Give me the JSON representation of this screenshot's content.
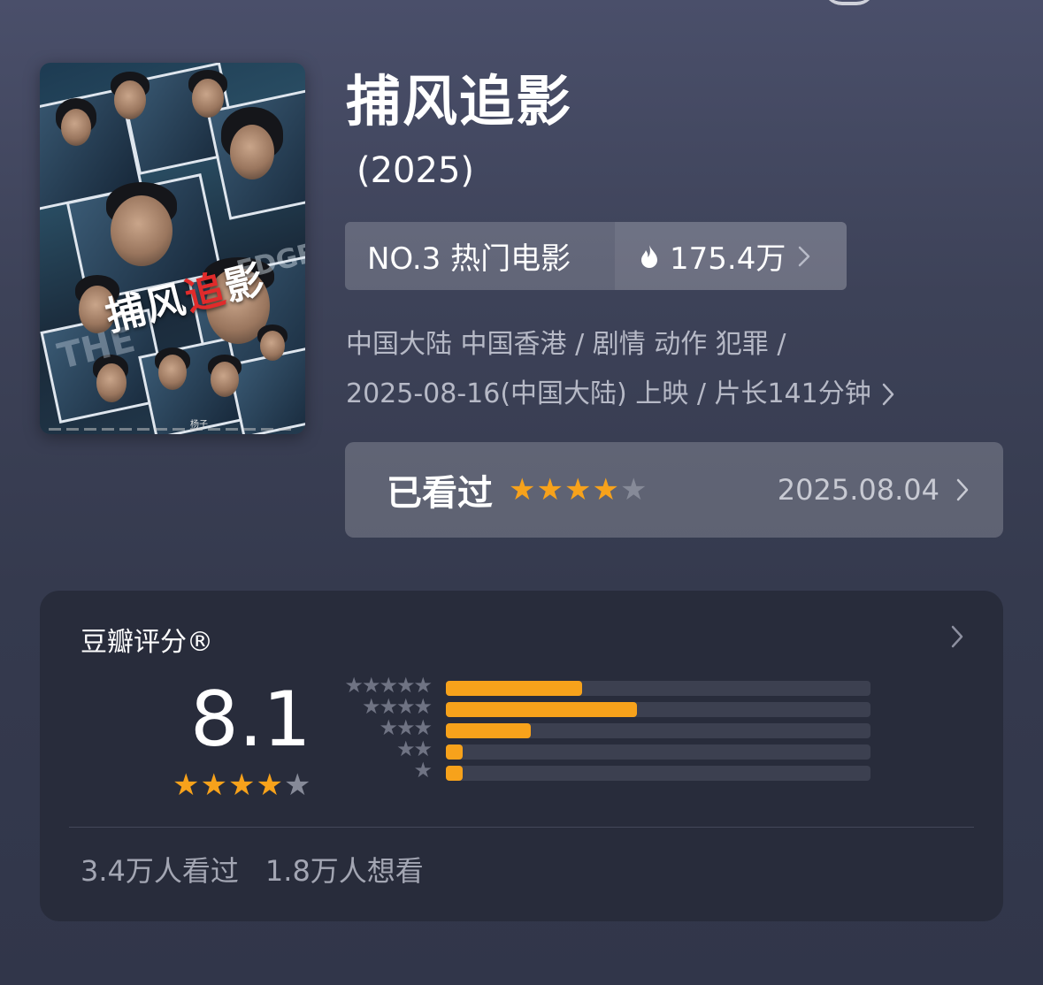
{
  "movie": {
    "title": "捕风追影",
    "year": "(2025)"
  },
  "poster": {
    "title_white_1": "捕风",
    "title_red": "追",
    "title_white_2": "影",
    "english_partial": "THE",
    "english_partial_2": "EDGE",
    "credit": "杨子"
  },
  "rank": {
    "label": "NO.3 热门电影",
    "heat": "175.4万"
  },
  "meta": {
    "line1": "中国大陆 中国香港 / 剧情 动作 犯罪 /",
    "line2": "2025-08-16(中国大陆) 上映 / 片长141分钟"
  },
  "watched": {
    "label": "已看过",
    "stars": 4,
    "max_stars": 5,
    "date": "2025.08.04"
  },
  "rating": {
    "title": "豆瓣评分®",
    "score": "8.1",
    "stars": 4,
    "distribution": [
      {
        "stars": 5,
        "label": "★★★★★",
        "percent": 32
      },
      {
        "stars": 4,
        "label": "★★★★",
        "percent": 45
      },
      {
        "stars": 3,
        "label": "★★★",
        "percent": 20
      },
      {
        "stars": 2,
        "label": "★★",
        "percent": 4
      },
      {
        "stars": 1,
        "label": "★",
        "percent": 4
      }
    ],
    "watched_count": "3.4万人看过",
    "wish_count": "1.8万人想看"
  },
  "colors": {
    "star_on": "#f7a21b",
    "star_off": "#868a98",
    "bar_fill": "#f7a21b"
  }
}
